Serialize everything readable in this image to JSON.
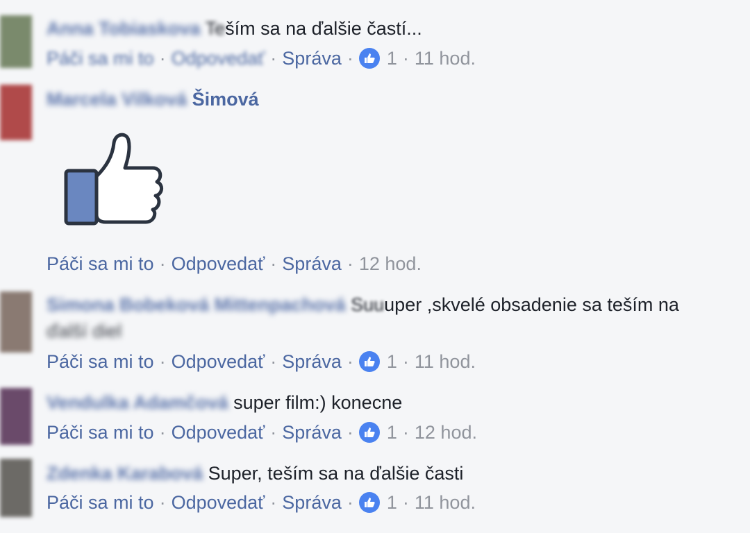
{
  "comments": [
    {
      "author_blurred": "Anna Tobiaskova",
      "author_visible": "",
      "text_blurred": "Te",
      "text": "ším sa na ďalšie častí...",
      "like_label": "Páči sa mi to",
      "reply_label": "Odpovedať",
      "message_label": "Správa",
      "reactions": "1",
      "time": "11 hod.",
      "avatar_color": "#7a8a6c"
    },
    {
      "author_blurred": "Marcela Vilková",
      "author_visible": "Šimová",
      "sticker": "thumbs-up-sticker",
      "like_label": "Páči sa mi to",
      "reply_label": "Odpovedať",
      "message_label": "Správa",
      "time": "12 hod.",
      "avatar_color": "#b04a4a"
    },
    {
      "author_blurred": "Simona Bobeková Mittenpachová",
      "text_blurred": "Suu",
      "text": "uper ,skvelé obsadenie sa teším na",
      "text_line2_blurred": "ďalší diel",
      "like_label": "Páči sa mi to",
      "reply_label": "Odpovedať",
      "message_label": "Správa",
      "reactions": "1",
      "time": "11 hod.",
      "avatar_color": "#8a7a72"
    },
    {
      "author_blurred": "Vendulka Adamčová",
      "text": "super film:) konecne",
      "like_label": "Páči sa mi to",
      "reply_label": "Odpovedať",
      "message_label": "Správa",
      "reactions": "1",
      "time": "12 hod.",
      "avatar_color": "#6a4a6a"
    },
    {
      "author_blurred": "Zdenka Karabová",
      "text": "Super, teším sa na ďalšie časti",
      "like_label": "Páči sa mi to",
      "reply_label": "Odpovedať",
      "message_label": "Správa",
      "reactions": "1",
      "time": "11 hod.",
      "avatar_color": "#6c6a66"
    }
  ],
  "colors": {
    "link": "#4b67a1",
    "muted": "#90949c",
    "like_badge": "#4a82f0",
    "background": "#f5f6f8"
  }
}
